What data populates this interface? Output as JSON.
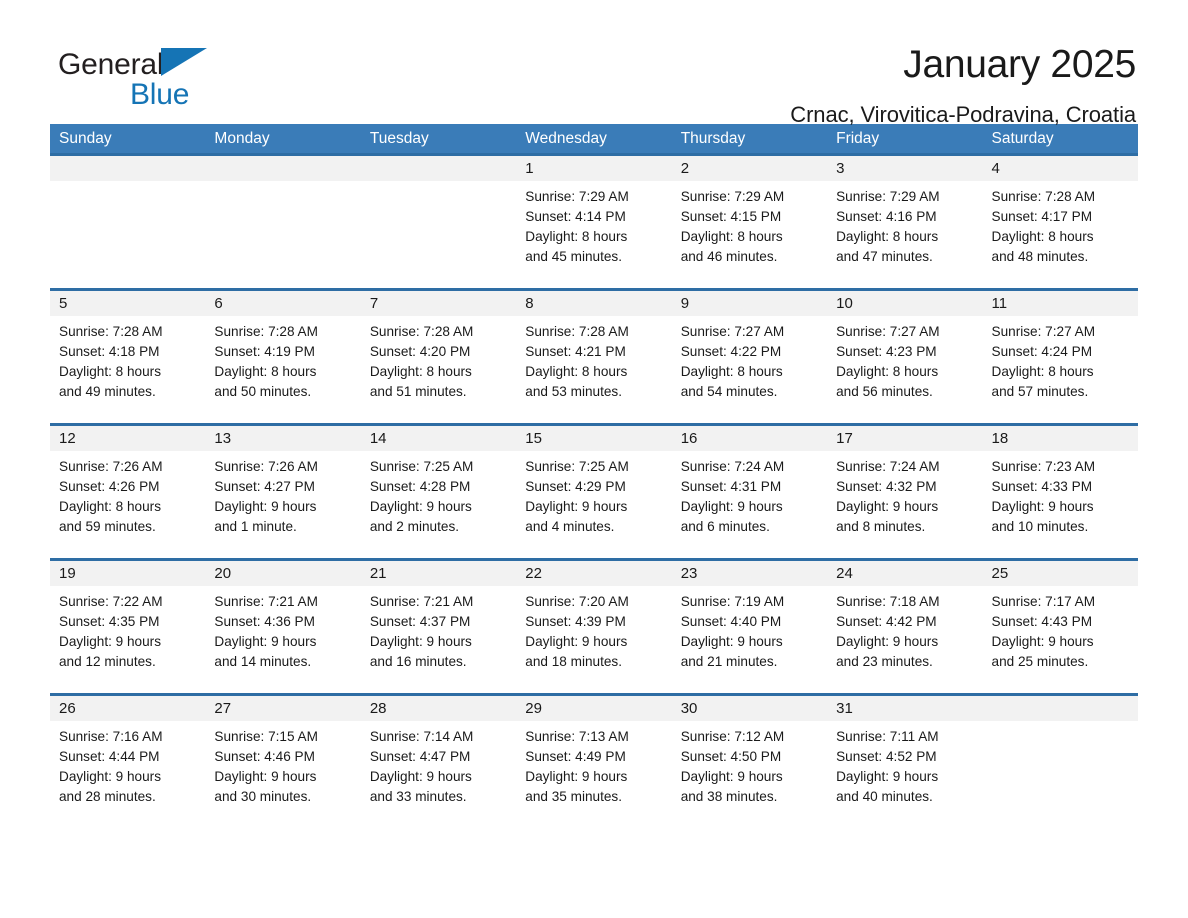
{
  "brand": {
    "word1": "General",
    "word2": "Blue"
  },
  "header": {
    "title": "January 2025",
    "subtitle": "Crnac, Virovitica-Podravina, Croatia"
  },
  "calendar": {
    "weekdays": [
      "Sunday",
      "Monday",
      "Tuesday",
      "Wednesday",
      "Thursday",
      "Friday",
      "Saturday"
    ],
    "accent_color": "#3a7cb8",
    "accent_border_color": "#2e6da4",
    "date_strip_color": "#f2f2f2",
    "weeks": [
      [
        {
          "date": "",
          "lines": [],
          "empty": true
        },
        {
          "date": "",
          "lines": [],
          "empty": true
        },
        {
          "date": "",
          "lines": [],
          "empty": true
        },
        {
          "date": "1",
          "lines": [
            "Sunrise: 7:29 AM",
            "Sunset: 4:14 PM",
            "Daylight: 8 hours",
            "and 45 minutes."
          ]
        },
        {
          "date": "2",
          "lines": [
            "Sunrise: 7:29 AM",
            "Sunset: 4:15 PM",
            "Daylight: 8 hours",
            "and 46 minutes."
          ]
        },
        {
          "date": "3",
          "lines": [
            "Sunrise: 7:29 AM",
            "Sunset: 4:16 PM",
            "Daylight: 8 hours",
            "and 47 minutes."
          ]
        },
        {
          "date": "4",
          "lines": [
            "Sunrise: 7:28 AM",
            "Sunset: 4:17 PM",
            "Daylight: 8 hours",
            "and 48 minutes."
          ]
        }
      ],
      [
        {
          "date": "5",
          "lines": [
            "Sunrise: 7:28 AM",
            "Sunset: 4:18 PM",
            "Daylight: 8 hours",
            "and 49 minutes."
          ]
        },
        {
          "date": "6",
          "lines": [
            "Sunrise: 7:28 AM",
            "Sunset: 4:19 PM",
            "Daylight: 8 hours",
            "and 50 minutes."
          ]
        },
        {
          "date": "7",
          "lines": [
            "Sunrise: 7:28 AM",
            "Sunset: 4:20 PM",
            "Daylight: 8 hours",
            "and 51 minutes."
          ]
        },
        {
          "date": "8",
          "lines": [
            "Sunrise: 7:28 AM",
            "Sunset: 4:21 PM",
            "Daylight: 8 hours",
            "and 53 minutes."
          ]
        },
        {
          "date": "9",
          "lines": [
            "Sunrise: 7:27 AM",
            "Sunset: 4:22 PM",
            "Daylight: 8 hours",
            "and 54 minutes."
          ]
        },
        {
          "date": "10",
          "lines": [
            "Sunrise: 7:27 AM",
            "Sunset: 4:23 PM",
            "Daylight: 8 hours",
            "and 56 minutes."
          ]
        },
        {
          "date": "11",
          "lines": [
            "Sunrise: 7:27 AM",
            "Sunset: 4:24 PM",
            "Daylight: 8 hours",
            "and 57 minutes."
          ]
        }
      ],
      [
        {
          "date": "12",
          "lines": [
            "Sunrise: 7:26 AM",
            "Sunset: 4:26 PM",
            "Daylight: 8 hours",
            "and 59 minutes."
          ]
        },
        {
          "date": "13",
          "lines": [
            "Sunrise: 7:26 AM",
            "Sunset: 4:27 PM",
            "Daylight: 9 hours",
            "and 1 minute."
          ]
        },
        {
          "date": "14",
          "lines": [
            "Sunrise: 7:25 AM",
            "Sunset: 4:28 PM",
            "Daylight: 9 hours",
            "and 2 minutes."
          ]
        },
        {
          "date": "15",
          "lines": [
            "Sunrise: 7:25 AM",
            "Sunset: 4:29 PM",
            "Daylight: 9 hours",
            "and 4 minutes."
          ]
        },
        {
          "date": "16",
          "lines": [
            "Sunrise: 7:24 AM",
            "Sunset: 4:31 PM",
            "Daylight: 9 hours",
            "and 6 minutes."
          ]
        },
        {
          "date": "17",
          "lines": [
            "Sunrise: 7:24 AM",
            "Sunset: 4:32 PM",
            "Daylight: 9 hours",
            "and 8 minutes."
          ]
        },
        {
          "date": "18",
          "lines": [
            "Sunrise: 7:23 AM",
            "Sunset: 4:33 PM",
            "Daylight: 9 hours",
            "and 10 minutes."
          ]
        }
      ],
      [
        {
          "date": "19",
          "lines": [
            "Sunrise: 7:22 AM",
            "Sunset: 4:35 PM",
            "Daylight: 9 hours",
            "and 12 minutes."
          ]
        },
        {
          "date": "20",
          "lines": [
            "Sunrise: 7:21 AM",
            "Sunset: 4:36 PM",
            "Daylight: 9 hours",
            "and 14 minutes."
          ]
        },
        {
          "date": "21",
          "lines": [
            "Sunrise: 7:21 AM",
            "Sunset: 4:37 PM",
            "Daylight: 9 hours",
            "and 16 minutes."
          ]
        },
        {
          "date": "22",
          "lines": [
            "Sunrise: 7:20 AM",
            "Sunset: 4:39 PM",
            "Daylight: 9 hours",
            "and 18 minutes."
          ]
        },
        {
          "date": "23",
          "lines": [
            "Sunrise: 7:19 AM",
            "Sunset: 4:40 PM",
            "Daylight: 9 hours",
            "and 21 minutes."
          ]
        },
        {
          "date": "24",
          "lines": [
            "Sunrise: 7:18 AM",
            "Sunset: 4:42 PM",
            "Daylight: 9 hours",
            "and 23 minutes."
          ]
        },
        {
          "date": "25",
          "lines": [
            "Sunrise: 7:17 AM",
            "Sunset: 4:43 PM",
            "Daylight: 9 hours",
            "and 25 minutes."
          ]
        }
      ],
      [
        {
          "date": "26",
          "lines": [
            "Sunrise: 7:16 AM",
            "Sunset: 4:44 PM",
            "Daylight: 9 hours",
            "and 28 minutes."
          ]
        },
        {
          "date": "27",
          "lines": [
            "Sunrise: 7:15 AM",
            "Sunset: 4:46 PM",
            "Daylight: 9 hours",
            "and 30 minutes."
          ]
        },
        {
          "date": "28",
          "lines": [
            "Sunrise: 7:14 AM",
            "Sunset: 4:47 PM",
            "Daylight: 9 hours",
            "and 33 minutes."
          ]
        },
        {
          "date": "29",
          "lines": [
            "Sunrise: 7:13 AM",
            "Sunset: 4:49 PM",
            "Daylight: 9 hours",
            "and 35 minutes."
          ]
        },
        {
          "date": "30",
          "lines": [
            "Sunrise: 7:12 AM",
            "Sunset: 4:50 PM",
            "Daylight: 9 hours",
            "and 38 minutes."
          ]
        },
        {
          "date": "31",
          "lines": [
            "Sunrise: 7:11 AM",
            "Sunset: 4:52 PM",
            "Daylight: 9 hours",
            "and 40 minutes."
          ]
        },
        {
          "date": "",
          "lines": [],
          "empty": true
        }
      ]
    ]
  }
}
